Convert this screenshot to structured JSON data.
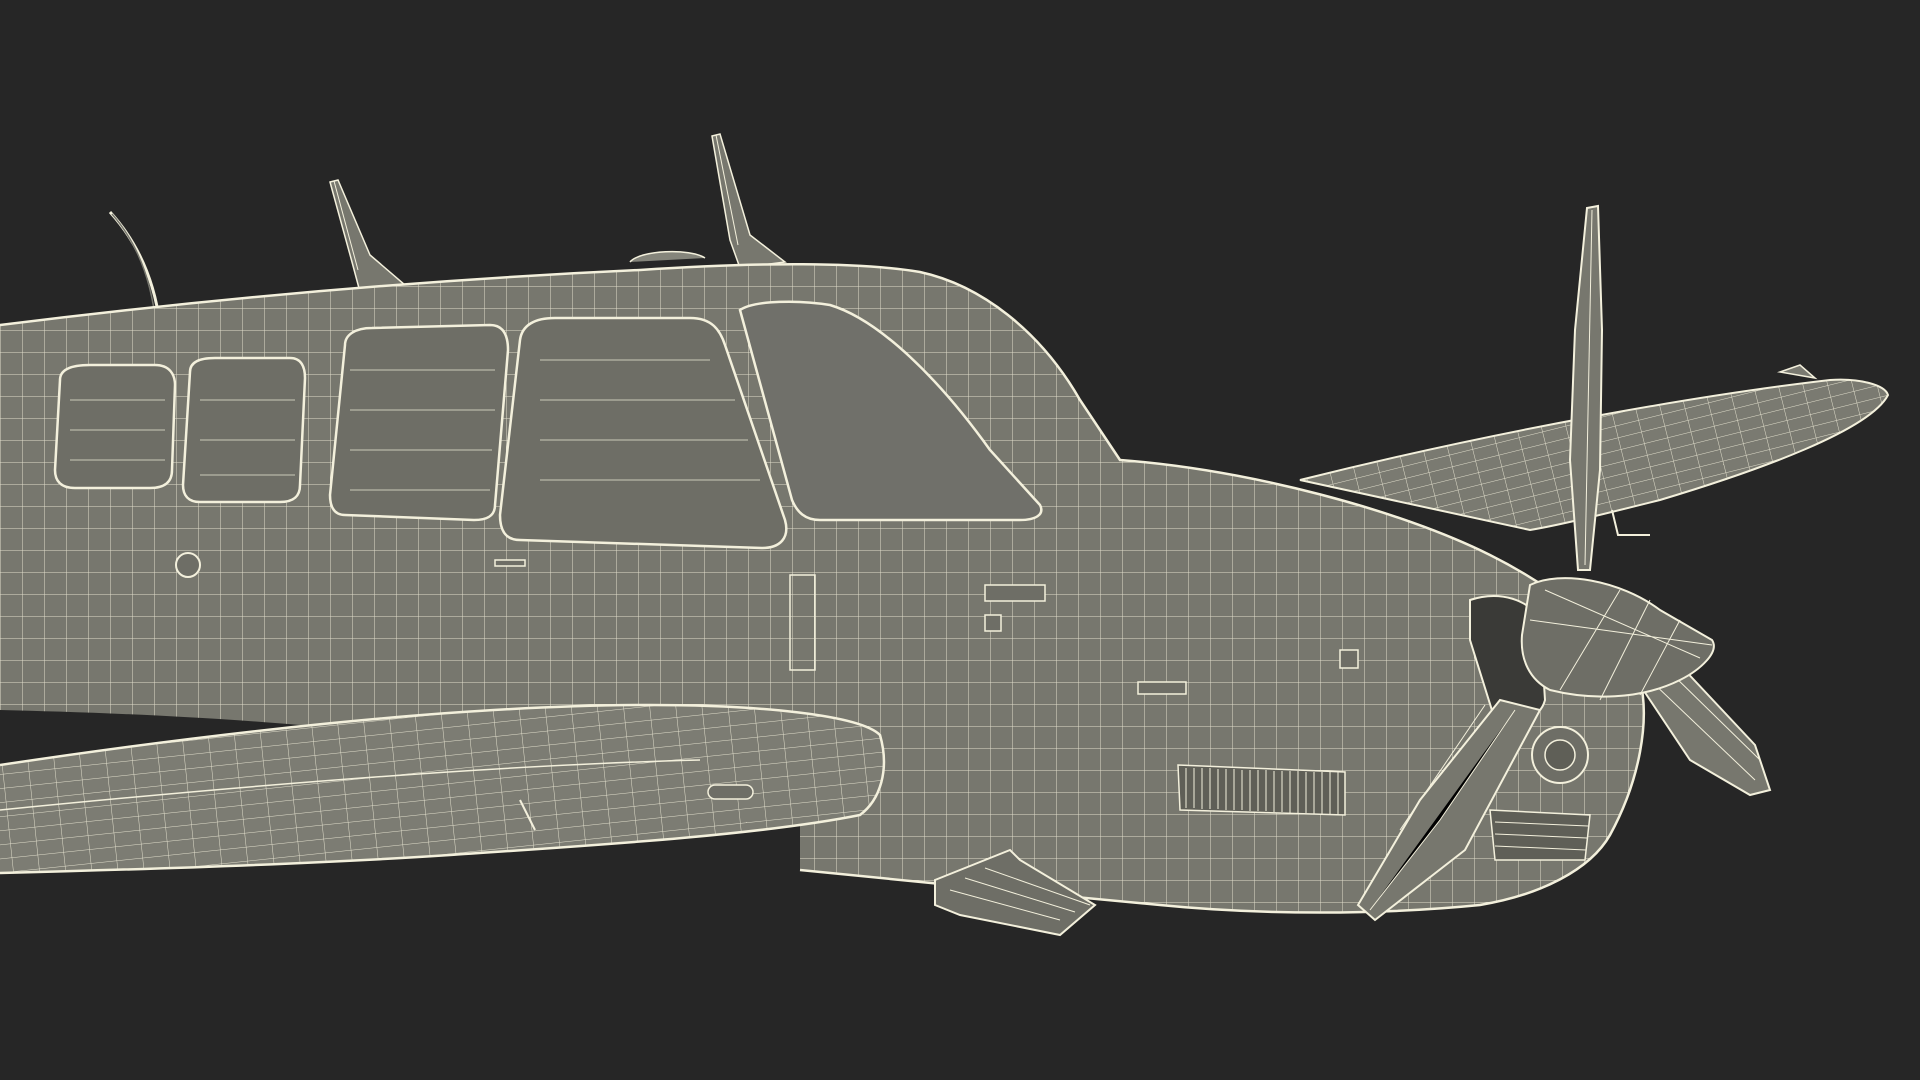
{
  "scene": {
    "subject": "aircraft-wireframe",
    "background_color": "#262626",
    "body_color": "#77776E",
    "body_shadow_color": "#5F5F57",
    "body_light_color": "#85857B",
    "wire_color": "#F3F0DC",
    "window_color": "#6E6E66"
  }
}
